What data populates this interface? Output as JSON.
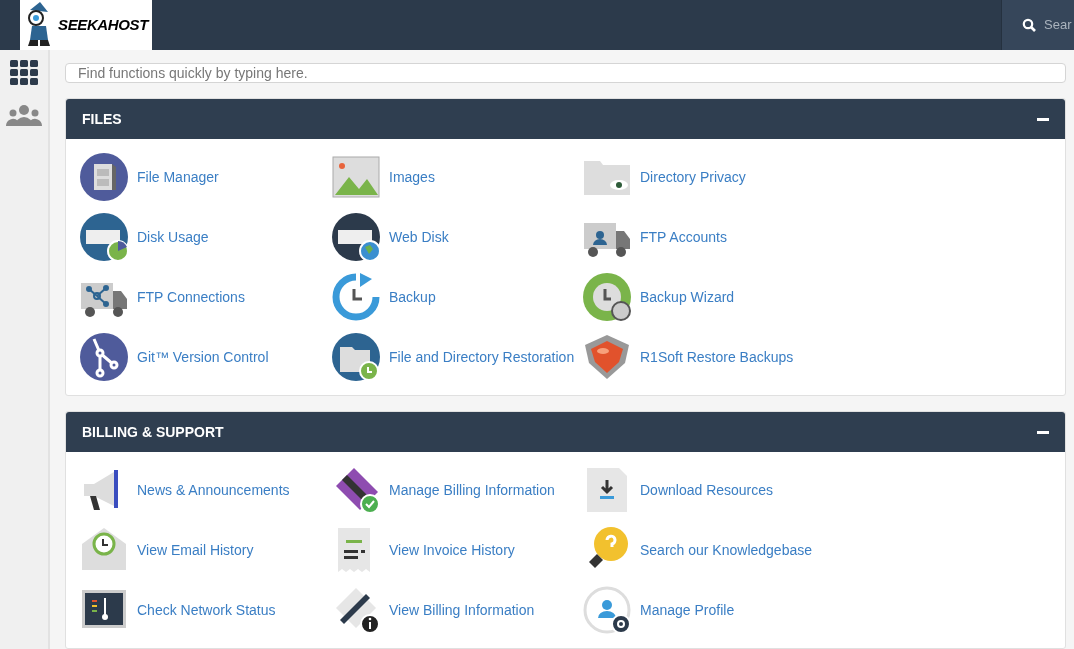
{
  "header": {
    "logo_text": "SEEKAHOST",
    "search": {
      "placeholder": "Sear"
    }
  },
  "quick_search": {
    "placeholder": "Find functions quickly by typing here."
  },
  "sections": [
    {
      "title": "FILES",
      "expanded": true,
      "items": [
        {
          "label": "File Manager"
        },
        {
          "label": "Images"
        },
        {
          "label": "Directory Privacy"
        },
        {
          "label": "Disk Usage"
        },
        {
          "label": "Web Disk"
        },
        {
          "label": "FTP Accounts"
        },
        {
          "label": "FTP Connections"
        },
        {
          "label": "Backup"
        },
        {
          "label": "Backup Wizard"
        },
        {
          "label": "Git™ Version Control"
        },
        {
          "label": "File and Directory Restoration"
        },
        {
          "label": "R1Soft Restore Backups"
        }
      ]
    },
    {
      "title": "BILLING & SUPPORT",
      "expanded": true,
      "items": [
        {
          "label": "News & Announcements"
        },
        {
          "label": "Manage Billing Information"
        },
        {
          "label": "Download Resources"
        },
        {
          "label": "View Email History"
        },
        {
          "label": "View Invoice History"
        },
        {
          "label": "Search our Knowledgebase"
        },
        {
          "label": "Check Network Status"
        },
        {
          "label": "View Billing Information"
        },
        {
          "label": "Manage Profile"
        }
      ]
    }
  ]
}
